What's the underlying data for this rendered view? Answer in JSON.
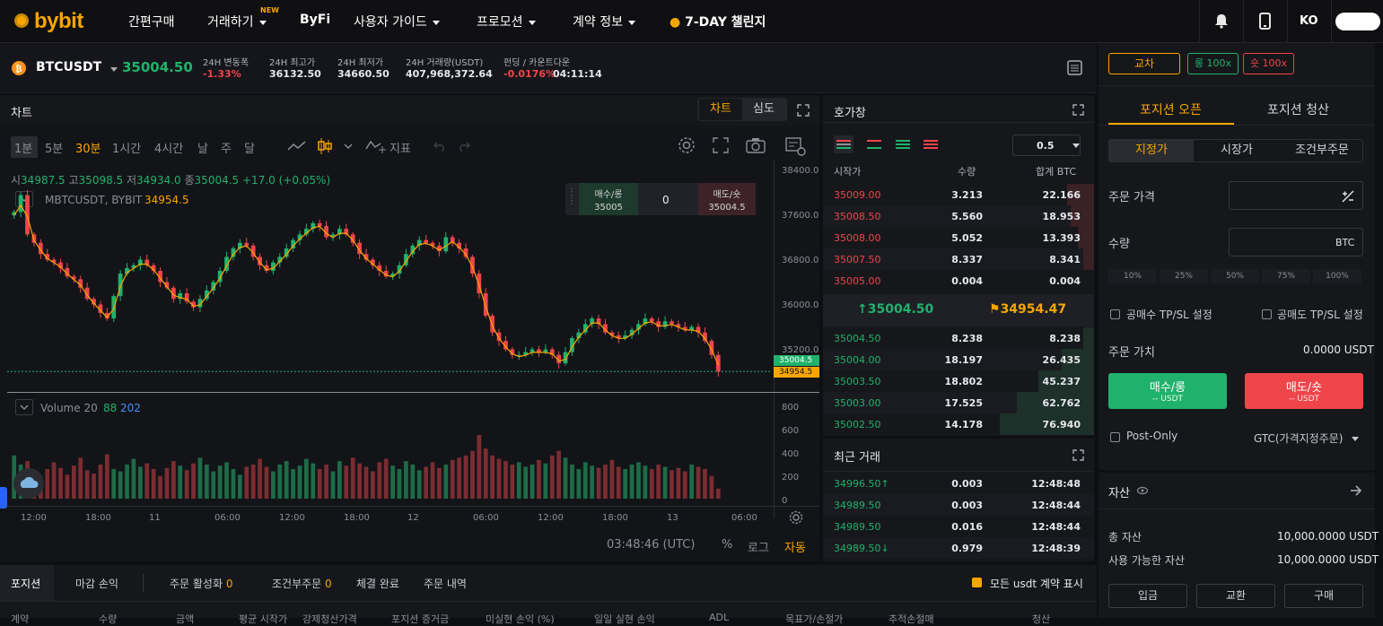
{
  "nav": {
    "logo": "bybit",
    "items": [
      "간편구매",
      "거래하기",
      "ByFi",
      "사용자 가이드",
      "프로모션",
      "계약 정보",
      "7-DAY 챌린지"
    ],
    "new_badge": "NEW",
    "lang": "KO"
  },
  "ticker": {
    "symbol": "BTCUSDT",
    "last_price": "35004.50",
    "stats": [
      {
        "label": "24H 변동폭",
        "value": "-1.33%"
      },
      {
        "label": "24H 최고가",
        "value": "36132.50"
      },
      {
        "label": "24H 최저가",
        "value": "34660.50"
      },
      {
        "label": "24H 거래량(USDT)",
        "value": "407,968,372.64"
      },
      {
        "label": "펀딩 / 카운트다운",
        "value": "-0.0176%",
        "value2": "04:11:14"
      }
    ]
  },
  "chart": {
    "panel_title": "차트",
    "view_tabs": [
      "차트",
      "심도"
    ],
    "timeframes": [
      "1분",
      "5분",
      "30분",
      "1시간",
      "4시간",
      "날",
      "주",
      "달"
    ],
    "active_timeframe": "30분",
    "indicator_label": "지표",
    "ohlc": {
      "o_label": "시",
      "o": "34987.5",
      "h_label": "고",
      "h": "35098.5",
      "l_label": "저",
      "l": "34934.0",
      "c_label": "종",
      "c": "35004.5",
      "chg": "+17.0 (+0.05%)"
    },
    "mark_label": "MBTCUSDT, BYBIT",
    "mark_value": "34954.5",
    "trade_widget": {
      "buy_label": "매수/롱",
      "buy_price": "35005",
      "spread": "0",
      "sell_label": "매도/숏",
      "sell_price": "35004.5"
    },
    "price_axis": [
      "38400.0",
      "37600.0",
      "36800.0",
      "36000.0",
      "35200.0"
    ],
    "price_tag_last": "35004.5",
    "price_tag_mark": "34954.5",
    "volume_label": "Volume 20",
    "volume_vals": [
      "88",
      "202"
    ],
    "volume_axis": [
      "800",
      "600",
      "400",
      "200",
      "0"
    ],
    "time_axis": [
      "12:00",
      "18:00",
      "11",
      "06:00",
      "12:00",
      "18:00",
      "12",
      "06:00",
      "12:00",
      "18:00",
      "13",
      "06:00"
    ],
    "clock": "03:48:46 (UTC)",
    "scale_opts": [
      "%",
      "로그",
      "자동"
    ]
  },
  "chart_data": {
    "type": "candlestick",
    "title": "",
    "symbol": "BTCUSDT",
    "interval": "30분",
    "ylim": [
      34800,
      38600
    ],
    "close_series": [
      37850,
      38150,
      37450,
      37300,
      37100,
      37000,
      36950,
      36850,
      36700,
      36650,
      36500,
      36300,
      36200,
      36050,
      35950,
      36350,
      36750,
      36850,
      36900,
      37000,
      36900,
      36800,
      36600,
      36500,
      36300,
      36400,
      36250,
      36150,
      36300,
      36450,
      36600,
      36800,
      37050,
      37200,
      37300,
      37250,
      37050,
      36900,
      36800,
      36950,
      37050,
      37200,
      37350,
      37450,
      37550,
      37650,
      37600,
      37400,
      37450,
      37550,
      37450,
      37300,
      37100,
      37000,
      36900,
      36800,
      36700,
      36750,
      36900,
      37100,
      37250,
      37350,
      37300,
      37250,
      37150,
      37400,
      37300,
      37200,
      37050,
      36750,
      36400,
      36000,
      35700,
      35550,
      35400,
      35300,
      35300,
      35350,
      35400,
      35350,
      35400,
      35300,
      35150,
      35350,
      35600,
      35700,
      35850,
      35950,
      35850,
      35700,
      35650,
      35600,
      35650,
      35750,
      35850,
      35950,
      35900,
      35800,
      35900,
      35850,
      35800,
      35750,
      35800,
      35700,
      35550,
      35300,
      35004.5
    ],
    "volume": [
      380,
      300,
      330,
      240,
      200,
      260,
      320,
      270,
      210,
      290,
      360,
      250,
      220,
      300,
      390,
      260,
      240,
      300,
      350,
      280,
      310,
      260,
      200,
      270,
      330,
      290,
      250,
      310,
      360,
      300,
      240,
      290,
      320,
      260,
      210,
      280,
      300,
      350,
      280,
      240,
      300,
      330,
      260,
      290,
      350,
      310,
      260,
      300,
      240,
      330,
      290,
      360,
      310,
      280,
      240,
      320,
      350,
      290,
      260,
      330,
      300,
      250,
      280,
      320,
      270,
      300,
      340,
      360,
      380,
      420,
      560,
      440,
      380,
      350,
      330,
      300,
      320,
      280,
      300,
      340,
      310,
      380,
      420,
      360,
      300,
      260,
      320,
      290,
      270,
      300,
      340,
      280,
      260,
      300,
      320,
      290,
      260,
      300,
      280,
      250,
      270,
      240,
      300,
      280,
      260,
      200,
      88
    ]
  },
  "orderbook": {
    "title": "호가창",
    "precision": "0.5",
    "headers": [
      "시작가",
      "수량",
      "합계 BTC"
    ],
    "asks": [
      {
        "price": "35009.00",
        "qty": "3.213",
        "total": "22.166",
        "depth": 0.29
      },
      {
        "price": "35008.50",
        "qty": "5.560",
        "total": "18.953",
        "depth": 0.25
      },
      {
        "price": "35008.00",
        "qty": "5.052",
        "total": "13.393",
        "depth": 0.17
      },
      {
        "price": "35007.50",
        "qty": "8.337",
        "total": "8.341",
        "depth": 0.11
      },
      {
        "price": "35005.00",
        "qty": "0.004",
        "total": "0.004",
        "depth": 0.0
      }
    ],
    "mid_last": "35004.50",
    "mid_mark": "34954.47",
    "bids": [
      {
        "price": "35004.50",
        "qty": "8.238",
        "total": "8.238",
        "depth": 0.11
      },
      {
        "price": "35004.00",
        "qty": "18.197",
        "total": "26.435",
        "depth": 0.34
      },
      {
        "price": "35003.50",
        "qty": "18.802",
        "total": "45.237",
        "depth": 0.59
      },
      {
        "price": "35003.00",
        "qty": "17.525",
        "total": "62.762",
        "depth": 0.82
      },
      {
        "price": "35002.50",
        "qty": "14.178",
        "total": "76.940",
        "depth": 1.0
      }
    ]
  },
  "trades": {
    "title": "최근 거래",
    "rows": [
      {
        "price": "34996.50",
        "arrow": "↑",
        "qty": "0.003",
        "time": "12:48:48"
      },
      {
        "price": "34989.50",
        "arrow": "",
        "qty": "0.003",
        "time": "12:48:44"
      },
      {
        "price": "34989.50",
        "arrow": "",
        "qty": "0.016",
        "time": "12:48:44"
      },
      {
        "price": "34989.50",
        "arrow": "↓",
        "qty": "0.979",
        "time": "12:48:39"
      }
    ]
  },
  "orderform": {
    "margin_mode": "교차",
    "long_lev": "롱 100x",
    "short_lev": "숏 100x",
    "tabs": [
      "포지션 오픈",
      "포지션 청산"
    ],
    "order_types": [
      "지정가",
      "시장가",
      "조건부주문"
    ],
    "price_label": "주문 가격",
    "qty_label": "수량",
    "qty_unit": "BTC",
    "pcts": [
      "10%",
      "25%",
      "50%",
      "75%",
      "100%"
    ],
    "tpsl_long": "공매수 TP/SL 설정",
    "tpsl_short": "공매도 TP/SL 설정",
    "value_label": "주문 가치",
    "value": "0.0000 USDT",
    "buy_btn": "매수/롱",
    "buy_sub": "-- USDT",
    "sell_btn": "매도/숏",
    "sell_sub": "-- USDT",
    "post_only": "Post-Only",
    "tif": "GTC(가격지정주문)"
  },
  "assets": {
    "title": "자산",
    "total_label": "총 자산",
    "total": "10,000.0000 USDT",
    "avail_label": "사용 가능한 자산",
    "avail": "10,000.0000 USDT",
    "buttons": [
      "입금",
      "교환",
      "구매"
    ]
  },
  "bottom": {
    "tabs": [
      {
        "label": "포지션",
        "count": ""
      },
      {
        "label": "마감 손익",
        "count": ""
      },
      {
        "label": "주문 활성화",
        "count": "0"
      },
      {
        "label": "조건부주문",
        "count": "0"
      },
      {
        "label": "체결 완료",
        "count": ""
      },
      {
        "label": "주문 내역",
        "count": ""
      }
    ],
    "show_all": "모든 usdt 계약 표시",
    "headers": [
      "계약",
      "수량",
      "금액",
      "평균 시작가",
      "강제청산가격",
      "포지션 증거금",
      "미실현 손익 (%)",
      "일일 실현 손익",
      "ADL",
      "목표가/손절가",
      "추적손절매",
      "청산"
    ]
  },
  "colors": {
    "accent": "#f7a600",
    "up": "#20b26c",
    "down": "#ef454a",
    "bg": "#16171b"
  }
}
